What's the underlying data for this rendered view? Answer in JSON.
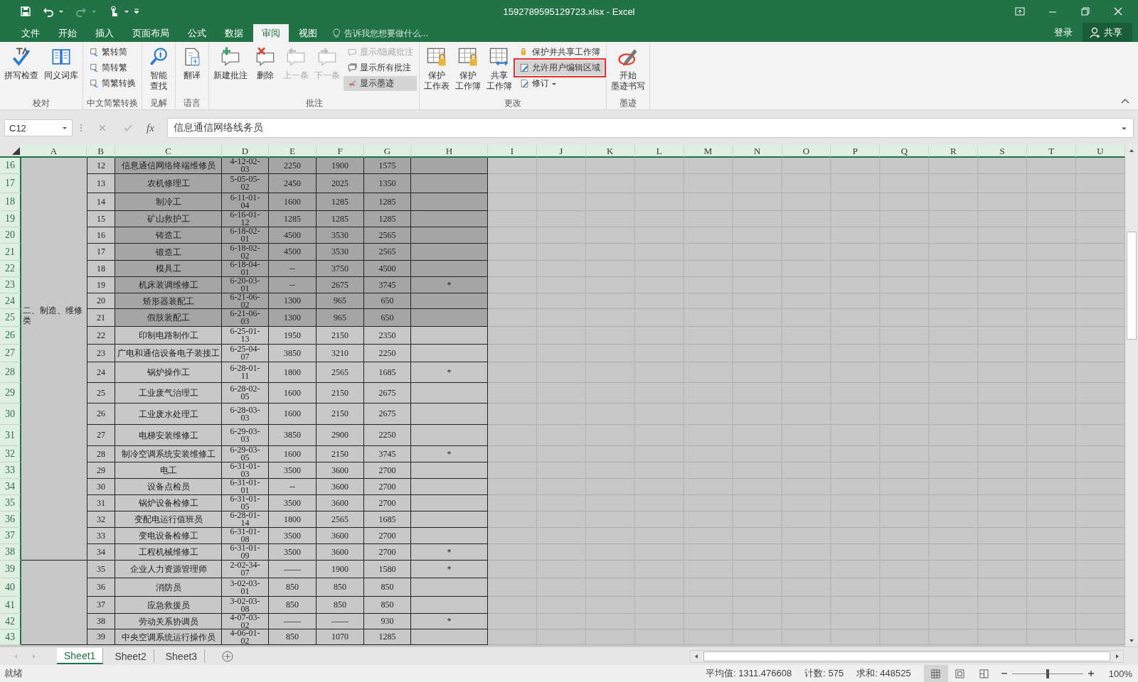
{
  "window": {
    "title": "1592789595129723.xlsx - Excel"
  },
  "menu_tabs": [
    {
      "label": "文件",
      "selected": false
    },
    {
      "label": "开始",
      "selected": false
    },
    {
      "label": "插入",
      "selected": false
    },
    {
      "label": "页面布局",
      "selected": false
    },
    {
      "label": "公式",
      "selected": false
    },
    {
      "label": "数据",
      "selected": false
    },
    {
      "label": "审阅",
      "selected": true
    },
    {
      "label": "视图",
      "selected": false
    }
  ],
  "tell_me": {
    "placeholder": "告诉我您想要做什么..."
  },
  "account": {
    "sign_in": "登录",
    "share": "共享"
  },
  "ribbon": {
    "groups": [
      {
        "label": "校对",
        "large": [
          {
            "label": "拼写检查",
            "kind": "wide",
            "disabled": false
          },
          {
            "label": "同义词库",
            "kind": "wide",
            "disabled": false
          }
        ]
      },
      {
        "label": "中文简繁转换",
        "small": [
          {
            "label": "繁转简",
            "kind": "plain",
            "disabled": false,
            "pressed": false,
            "marked": false
          },
          {
            "label": "简转繁",
            "kind": "plain",
            "disabled": false,
            "pressed": false,
            "marked": false
          },
          {
            "label": "简繁转换",
            "kind": "plain",
            "disabled": false,
            "pressed": false,
            "marked": false
          }
        ]
      },
      {
        "label": "见解",
        "large": [
          {
            "label": "智能查找",
            "kind": "stacked",
            "disabled": false
          }
        ]
      },
      {
        "label": "语言",
        "large": [
          {
            "label": "翻译",
            "kind": "wide",
            "disabled": false
          }
        ]
      },
      {
        "label": "批注",
        "large": [
          {
            "label": "新建批注",
            "kind": "wide",
            "disabled": false
          },
          {
            "label": "删除",
            "kind": "wide",
            "disabled": false
          },
          {
            "label": "上一条",
            "kind": "wide",
            "disabled": true
          },
          {
            "label": "下一条",
            "kind": "wide",
            "disabled": true
          }
        ],
        "small": [
          {
            "label": "显示/隐藏批注",
            "kind": "plain",
            "disabled": true,
            "pressed": false,
            "marked": false
          },
          {
            "label": "显示所有批注",
            "kind": "plain",
            "disabled": false,
            "pressed": false,
            "marked": false
          },
          {
            "label": "显示墨迹",
            "kind": "plain",
            "disabled": false,
            "pressed": true,
            "marked": false
          }
        ]
      },
      {
        "label": "更改",
        "large": [
          {
            "label": "保护工作表",
            "kind": "stacked",
            "disabled": false
          },
          {
            "label": "保护工作簿",
            "kind": "stacked",
            "disabled": false
          },
          {
            "label": "共享工作簿",
            "kind": "stacked",
            "disabled": false
          }
        ],
        "small": [
          {
            "label": "保护并共享工作簿",
            "kind": "plain",
            "disabled": false,
            "pressed": false,
            "marked": false
          },
          {
            "label": "允许用户编辑区域",
            "kind": "plain",
            "disabled": false,
            "pressed": true,
            "marked": true
          },
          {
            "label": "修订",
            "kind": "dropdown",
            "disabled": false,
            "pressed": false,
            "marked": false
          }
        ]
      },
      {
        "label": "墨迹",
        "large": [
          {
            "label": "开始墨迹书写",
            "kind": "stacked",
            "disabled": false
          }
        ]
      }
    ]
  },
  "formula_bar": {
    "name_box": "C12",
    "fx_label": "fx",
    "value": "信息通信网络线务员"
  },
  "sheet": {
    "columns": [
      "A",
      "B",
      "C",
      "D",
      "E",
      "F",
      "G",
      "H",
      "I",
      "J",
      "K",
      "L",
      "M",
      "N",
      "O",
      "P",
      "Q",
      "R",
      "S",
      "T",
      "U"
    ],
    "groups": [
      {
        "label": "二、制造、维修类",
        "rows": [
          {
            "num": "16",
            "b": "12",
            "c": "信息通信网络终端维修员",
            "d": "4-12-02-03",
            "e": "2250",
            "f": "1900",
            "g": "1575",
            "selected": true
          },
          {
            "num": "17",
            "b": "13",
            "c": "农机修理工",
            "d": "5-05-05-02",
            "e": "2450",
            "f": "2025",
            "g": "1350",
            "selected": true
          },
          {
            "num": "18",
            "b": "14",
            "c": "制冷工",
            "d": "6-11-01-04",
            "e": "1600",
            "f": "1285",
            "g": "1285",
            "selected": true
          },
          {
            "num": "19",
            "b": "15",
            "c": "矿山救护工",
            "d": "6-16-01-12",
            "e": "1285",
            "f": "1285",
            "g": "1285",
            "selected": true
          },
          {
            "num": "20",
            "b": "16",
            "c": "铸造工",
            "d": "6-18-02-01",
            "e": "4500",
            "f": "3530",
            "g": "2565",
            "selected": true
          },
          {
            "num": "21",
            "b": "17",
            "c": "锻造工",
            "d": "6-18-02-02",
            "e": "4500",
            "f": "3530",
            "g": "2565",
            "selected": true
          },
          {
            "num": "22",
            "b": "18",
            "c": "模具工",
            "d": "6-18-04-01",
            "e": "--",
            "f": "3750",
            "g": "4500",
            "selected": true
          },
          {
            "num": "23",
            "b": "19",
            "c": "机床装调维修工",
            "d": "6-20-03-01",
            "e": "--",
            "f": "2675",
            "g": "3745",
            "h": "*",
            "selected": true
          },
          {
            "num": "24",
            "b": "20",
            "c": "矫形器装配工",
            "d": "6-21-06-02",
            "e": "1300",
            "f": "965",
            "g": "650",
            "selected": true
          },
          {
            "num": "25",
            "b": "21",
            "c": "假肢装配工",
            "d": "6-21-06-03",
            "e": "1300",
            "f": "965",
            "g": "650",
            "selected": true
          },
          {
            "num": "26",
            "b": "22",
            "c": "印制电路制作工",
            "d": "6-25-01-13",
            "e": "1950",
            "f": "2150",
            "g": "2350",
            "selected": false
          },
          {
            "num": "27",
            "b": "23",
            "c": "广电和通信设备电子装接工",
            "d": "6-25-04-07",
            "e": "3850",
            "f": "3210",
            "g": "2250",
            "selected": false
          },
          {
            "num": "28",
            "b": "24",
            "c": "锅炉操作工",
            "d": "6-28-01-11",
            "e": "1800",
            "f": "2565",
            "g": "1685",
            "h": "*",
            "selected": false
          },
          {
            "num": "29",
            "b": "25",
            "c": "工业废气治理工",
            "d": "6-28-02-05",
            "e": "1600",
            "f": "2150",
            "g": "2675",
            "selected": false
          },
          {
            "num": "30",
            "b": "26",
            "c": "工业废水处理工",
            "d": "6-28-03-03",
            "e": "1600",
            "f": "2150",
            "g": "2675",
            "selected": false
          },
          {
            "num": "31",
            "b": "27",
            "c": "电梯安装维修工",
            "d": "6-29-03-03",
            "e": "3850",
            "f": "2900",
            "g": "2250",
            "selected": false
          },
          {
            "num": "32",
            "b": "28",
            "c": "制冷空调系统安装维修工",
            "d": "6-29-03-05",
            "e": "1600",
            "f": "2150",
            "g": "3745",
            "h": "*",
            "selected": false
          },
          {
            "num": "33",
            "b": "29",
            "c": "电工",
            "d": "6-31-01-03",
            "e": "3500",
            "f": "3600",
            "g": "2700",
            "selected": false
          },
          {
            "num": "34",
            "b": "30",
            "c": "设备点检员",
            "d": "6-31-01-01",
            "e": "--",
            "f": "3600",
            "g": "2700",
            "selected": false
          },
          {
            "num": "35",
            "b": "31",
            "c": "锅炉设备检修工",
            "d": "6-31-01-05",
            "e": "3500",
            "f": "3600",
            "g": "2700",
            "selected": false
          },
          {
            "num": "36",
            "b": "32",
            "c": "变配电运行值班员",
            "d": "6-28-01-14",
            "e": "1800",
            "f": "2565",
            "g": "1685",
            "selected": false
          },
          {
            "num": "37",
            "b": "33",
            "c": "变电设备检修工",
            "d": "6-31-01-08",
            "e": "3500",
            "f": "3600",
            "g": "2700",
            "selected": false
          },
          {
            "num": "38",
            "b": "34",
            "c": "工程机械维修工",
            "d": "6-31-01-09",
            "e": "3500",
            "f": "3600",
            "g": "2700",
            "h": "*",
            "selected": false
          }
        ]
      },
      {
        "rows": [
          {
            "num": "39",
            "b": "35",
            "c": "企业人力资源管理师",
            "d": "2-02-34-07",
            "e": "——",
            "f": "1900",
            "g": "1580",
            "h": "*",
            "selected": false
          },
          {
            "num": "40",
            "b": "36",
            "c": "消防员",
            "d": "3-02-03-01",
            "e": "850",
            "f": "850",
            "g": "850",
            "selected": false
          },
          {
            "num": "41",
            "b": "37",
            "c": "应急救援员",
            "d": "3-02-03-08",
            "e": "850",
            "f": "850",
            "g": "850",
            "selected": false
          },
          {
            "num": "42",
            "b": "38",
            "c": "劳动关系协调员",
            "d": "4-07-03-02",
            "e": "——",
            "f": "——",
            "g": "930",
            "h": "*",
            "selected": false
          },
          {
            "num": "43",
            "b": "39",
            "c": "中央空调系统运行操作员",
            "d": "4-06-01-02",
            "e": "850",
            "f": "1070",
            "g": "1285",
            "selected": false
          }
        ]
      }
    ]
  },
  "sheet_tabs": [
    {
      "label": "Sheet1",
      "selected": true
    },
    {
      "label": "Sheet2",
      "selected": false
    },
    {
      "label": "Sheet3",
      "selected": false
    }
  ],
  "status_bar": {
    "status": "就绪",
    "stats": [
      "平均值: 1311.476608",
      "计数: 575",
      "求和: 448525"
    ],
    "view_modes": [
      {
        "selected": true
      },
      {
        "selected": false
      },
      {
        "selected": false
      }
    ],
    "zoom": {
      "level": 0.5,
      "reading": "100%"
    }
  }
}
